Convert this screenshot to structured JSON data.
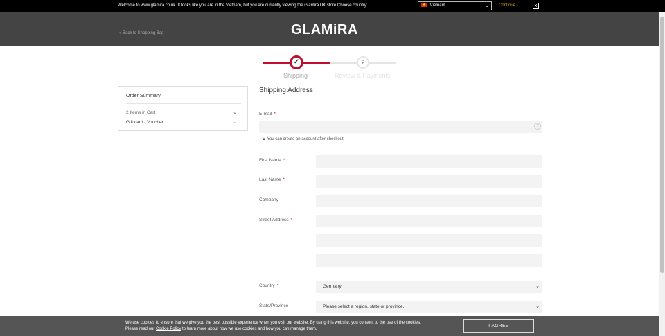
{
  "topbar": {
    "message": "Welcome to www.glamira.co.uk. It looks like you are in the Vietnam, but you are currently viewing the Glamira UK store Choose country:",
    "country": "Vietnam",
    "continue": "Continue ›",
    "close": "x"
  },
  "header": {
    "back": "« Back to Shopping Bag",
    "logo": "GLAMiRA"
  },
  "steps": {
    "step1_icon": "✓",
    "step1_label": "Shipping",
    "step2_number": "2",
    "step2_label": "Review & Payments"
  },
  "summary": {
    "title": "Order Summary",
    "items": "2 Items in Cart",
    "gift": "Gift card / Voucher",
    "chevron": "⌄"
  },
  "form": {
    "heading": "Shipping Address",
    "email_label": "E-mail",
    "required_mark": "*",
    "help": "?",
    "note": "▲  You can create an account after checkout.",
    "first_name_label": "First Name",
    "last_name_label": "Last Name",
    "company_label": "Company",
    "street_label": "Street Address",
    "country_label": "Country",
    "country_value": "Germany",
    "state_label": "State/Province",
    "state_value": "Please select a region, state or province."
  },
  "cookie": {
    "line1": "We use cookies to ensure that we give you the best possible experience when you visit our website. By using this website, you consent to the use of the cookies.",
    "line2_prefix": "Please read our ",
    "link": "Cookie Policy",
    "line2_suffix": " to learn more about how we use cookies and how you can manage them.",
    "agree": "I AGREE"
  },
  "colors": {
    "accent": "#c0102e",
    "header_bg": "#444444",
    "topbar_bg": "#000000",
    "cookie_bg": "#555555"
  }
}
